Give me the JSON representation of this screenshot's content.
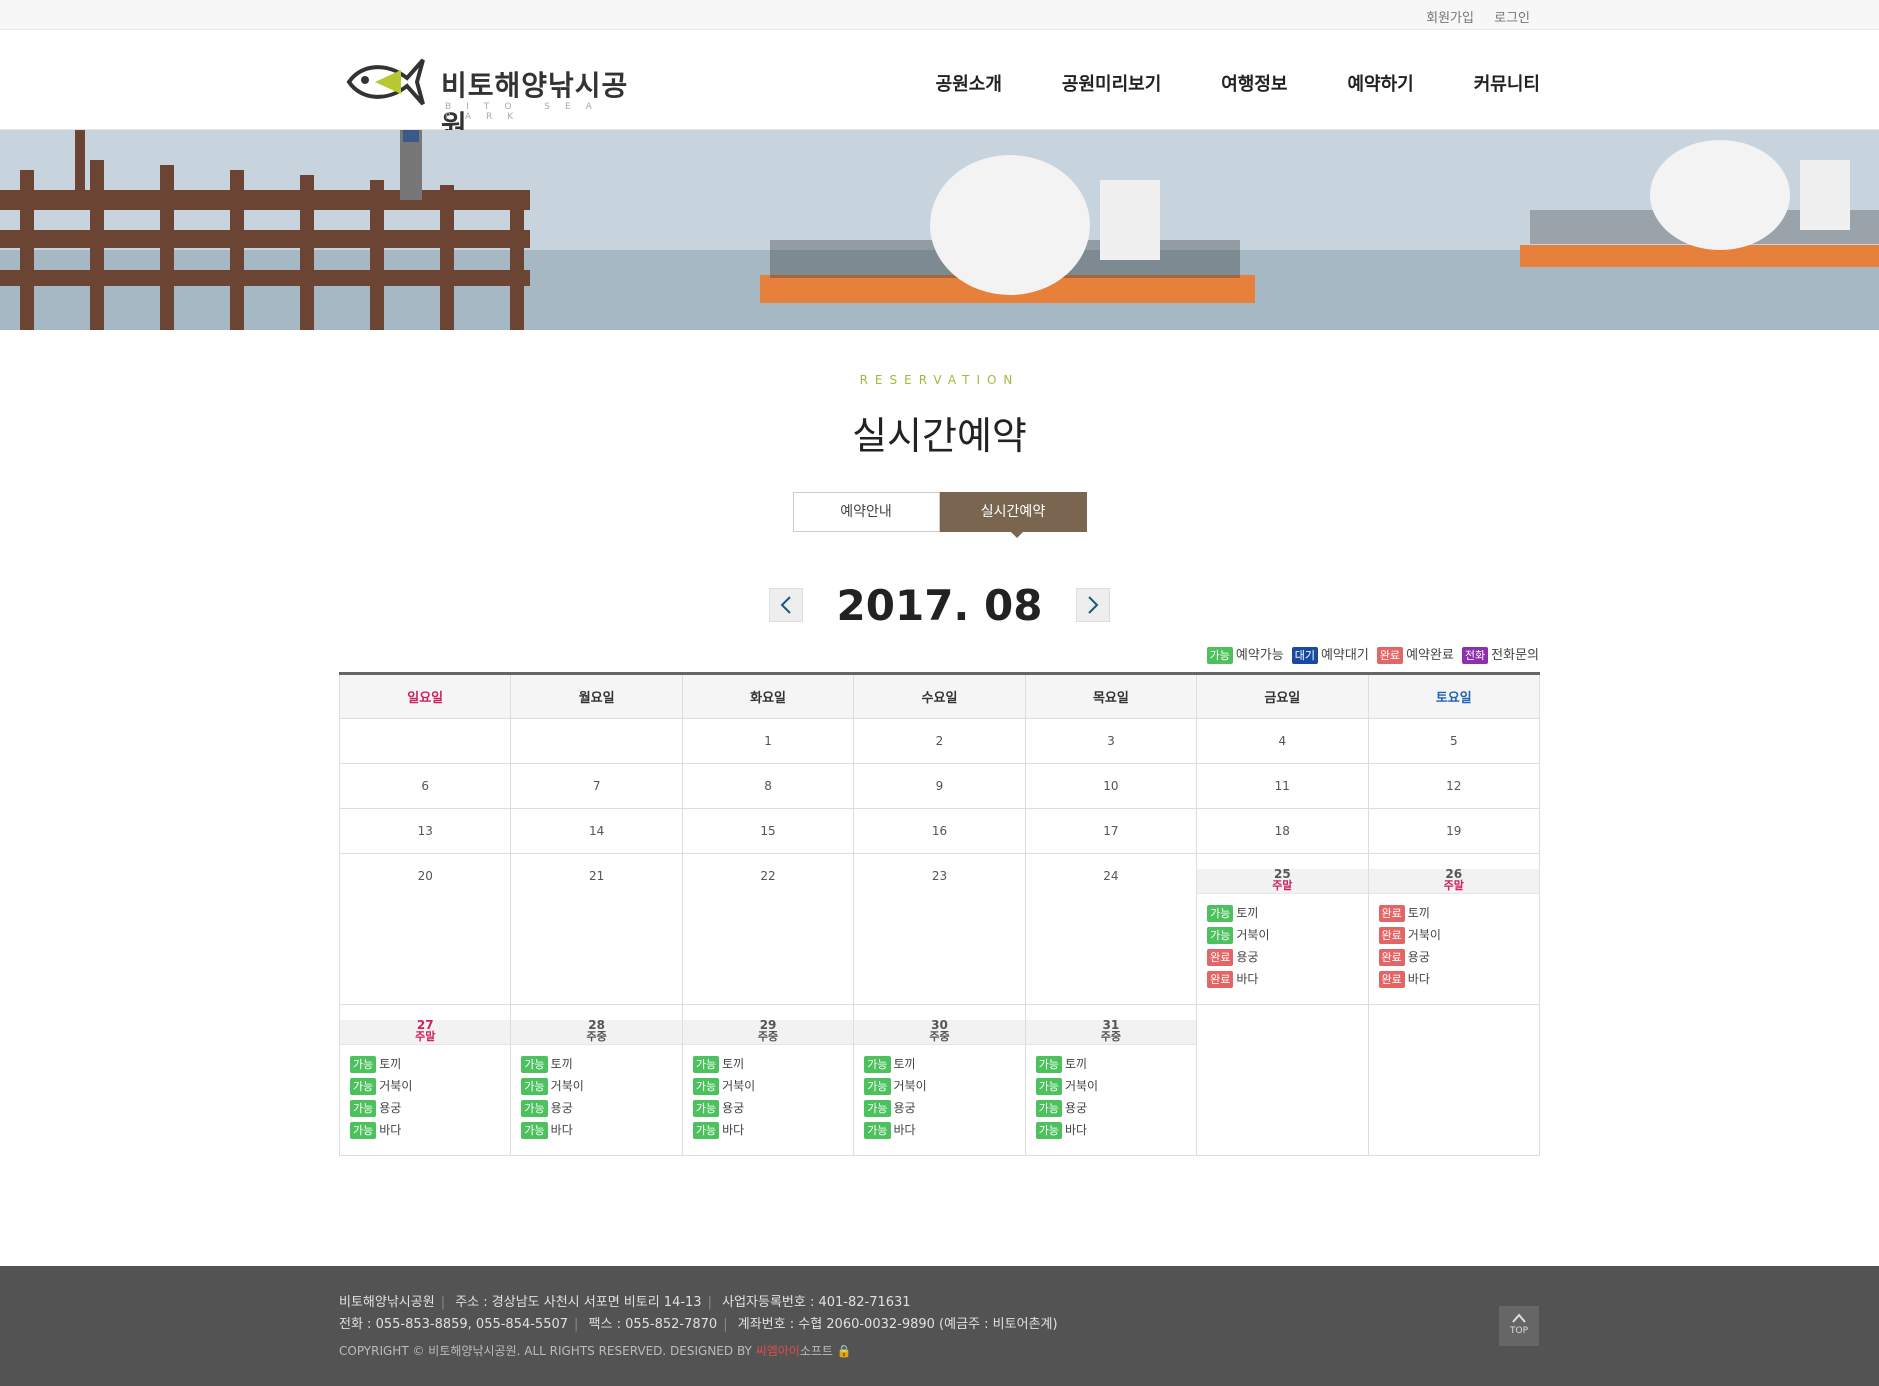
{
  "topbar": {
    "join": "회원가입",
    "login": "로그인"
  },
  "logo": {
    "name": "비토해양낚시공원",
    "sub": "BITO SEA PARK"
  },
  "nav": [
    "공원소개",
    "공원미리보기",
    "여행정보",
    "예약하기",
    "커뮤니티"
  ],
  "section": {
    "eyebrow": "RESERVATION",
    "title": "실시간예약"
  },
  "tabs": [
    {
      "label": "예약안내",
      "active": false
    },
    {
      "label": "실시간예약",
      "active": true
    }
  ],
  "calendar": {
    "month": "2017. 08",
    "legend": [
      {
        "badge": "가능",
        "label": "예약가능",
        "cls": "b-ok"
      },
      {
        "badge": "대기",
        "label": "예약대기",
        "cls": "b-wait"
      },
      {
        "badge": "완료",
        "label": "예약완료",
        "cls": "b-done"
      },
      {
        "badge": "전화",
        "label": "전화문의",
        "cls": "b-tel"
      }
    ],
    "weekdays": [
      "일요일",
      "월요일",
      "화요일",
      "수요일",
      "목요일",
      "금요일",
      "토요일"
    ],
    "rooms": [
      "토끼",
      "거북이",
      "용궁",
      "바다"
    ],
    "status_labels": {
      "ok": "가능",
      "done": "완료"
    },
    "weeks": [
      [
        null,
        null,
        {
          "day": "1"
        },
        {
          "day": "2"
        },
        {
          "day": "3"
        },
        {
          "day": "4"
        },
        {
          "day": "5"
        }
      ],
      [
        {
          "day": "6"
        },
        {
          "day": "7"
        },
        {
          "day": "8"
        },
        {
          "day": "9"
        },
        {
          "day": "10"
        },
        {
          "day": "11"
        },
        {
          "day": "12"
        }
      ],
      [
        {
          "day": "13"
        },
        {
          "day": "14"
        },
        {
          "day": "15"
        },
        {
          "day": "16"
        },
        {
          "day": "17"
        },
        {
          "day": "18"
        },
        {
          "day": "19"
        }
      ],
      [
        {
          "day": "20"
        },
        {
          "day": "21"
        },
        {
          "day": "22"
        },
        {
          "day": "23"
        },
        {
          "day": "24"
        },
        {
          "day": "25",
          "type": "주말",
          "weekend": true,
          "status": [
            "ok",
            "ok",
            "done",
            "done"
          ]
        },
        {
          "day": "26",
          "type": "주말",
          "weekend": true,
          "status": [
            "done",
            "done",
            "done",
            "done"
          ]
        }
      ],
      [
        {
          "day": "27",
          "type": "주말",
          "weekend": true,
          "red": true,
          "status": [
            "ok",
            "ok",
            "ok",
            "ok"
          ]
        },
        {
          "day": "28",
          "type": "주중",
          "status": [
            "ok",
            "ok",
            "ok",
            "ok"
          ]
        },
        {
          "day": "29",
          "type": "주중",
          "status": [
            "ok",
            "ok",
            "ok",
            "ok"
          ]
        },
        {
          "day": "30",
          "type": "주중",
          "status": [
            "ok",
            "ok",
            "ok",
            "ok"
          ]
        },
        {
          "day": "31",
          "type": "주중",
          "status": [
            "ok",
            "ok",
            "ok",
            "ok"
          ]
        },
        null,
        null
      ]
    ]
  },
  "footer": {
    "line1": [
      "비토해양낚시공원",
      "주소 : 경상남도 사천시 서포면 비토리 14-13",
      "사업자등록번호 : 401-82-71631"
    ],
    "line2": [
      "전화 : 055-853-8859, 055-854-5507",
      "팩스 : 055-852-7870",
      "계좌번호 : 수협 2060-0032-9890 (예금주 : 비토어촌계)"
    ],
    "copy": "COPYRIGHT © 비토해양낚시공원. ALL RIGHTS RESERVED. DESIGNED BY ",
    "designer_red": "씨엠아이",
    "designer": "소프트",
    "top": "TOP"
  },
  "colors": {
    "accent": "#7a6650",
    "sunday": "#d0205f",
    "saturday": "#1f64b0",
    "footer_bg": "#535353"
  }
}
